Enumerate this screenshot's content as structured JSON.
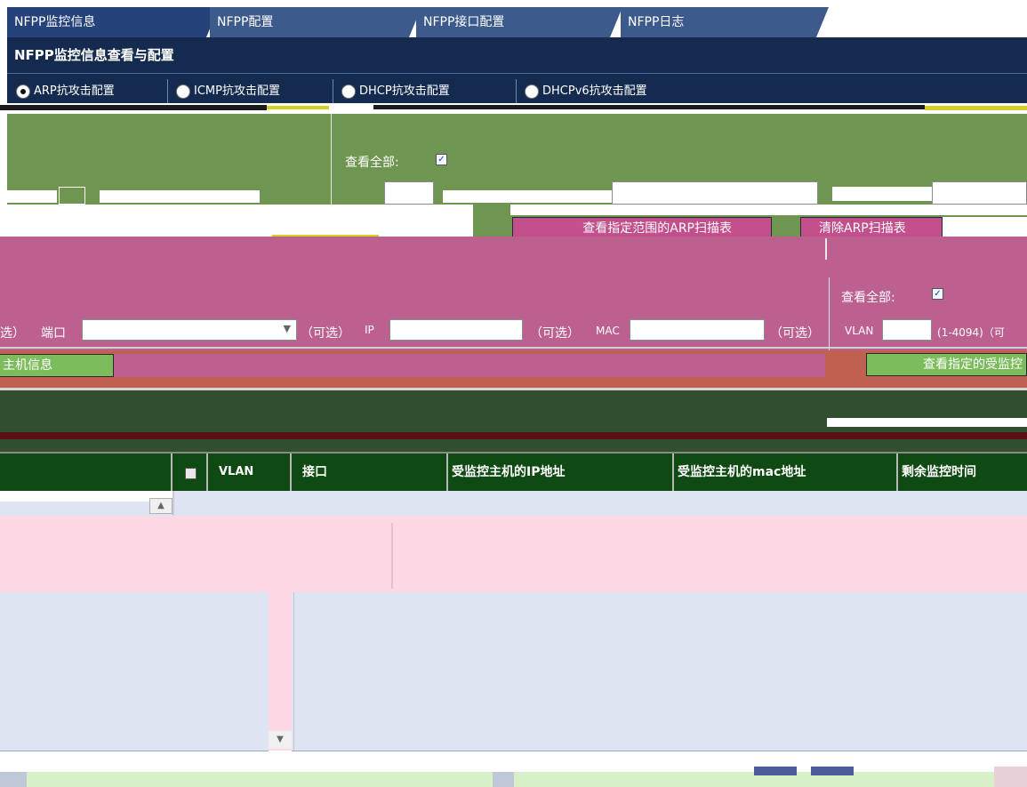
{
  "tabs": [
    {
      "label": "NFPP监控信息"
    },
    {
      "label": "NFPP配置"
    },
    {
      "label": "NFPP接口配置"
    },
    {
      "label": "NFPP日志"
    }
  ],
  "header": {
    "title": "NFPP监控信息查看与配置"
  },
  "attack_radios": [
    {
      "label": "ARP抗攻击配置",
      "selected": true
    },
    {
      "label": "ICMP抗攻击配置",
      "selected": false
    },
    {
      "label": "DHCP抗攻击配置",
      "selected": false
    },
    {
      "label": "DHCPv6抗攻击配置",
      "selected": false
    }
  ],
  "arp_panel": {
    "view_all_label": "查看全部:",
    "view_all_checked": true,
    "view_range_button": "查看指定范围的ARP扫描表",
    "clear_button": "清除ARP扫描表"
  },
  "host_panel": {
    "view_all_label": "查看全部:",
    "view_all_checked": true,
    "port_label_left": "选）",
    "port_label": "端口",
    "optional_1": "（可选）",
    "ip_label": "IP",
    "optional_2": "（可选）",
    "mac_label": "MAC",
    "optional_3": "（可选）",
    "vlan_label": "VLAN",
    "vlan_range": "(1-4094)（可",
    "host_info_button": "主机信息",
    "view_monitored_button": "查看指定的受监控"
  },
  "table": {
    "columns": [
      {
        "label": "VLAN"
      },
      {
        "label": "接口"
      },
      {
        "label": "受监控主机的IP地址"
      },
      {
        "label": "受监控主机的mac地址"
      },
      {
        "label": "剩余监控时间"
      }
    ],
    "rows": []
  },
  "colors": {
    "tab_bg": "#3d5a8c",
    "header_bg": "#142a4f",
    "arp_panel_bg": "#6f9650",
    "host_panel_bg": "#bc6090",
    "host_band_bg": "#c06050",
    "table_header_bg": "#0f4a12",
    "table_body_bg": "#dfe4f2",
    "button_magenta": "#c3508d",
    "button_green": "#78b05a"
  }
}
